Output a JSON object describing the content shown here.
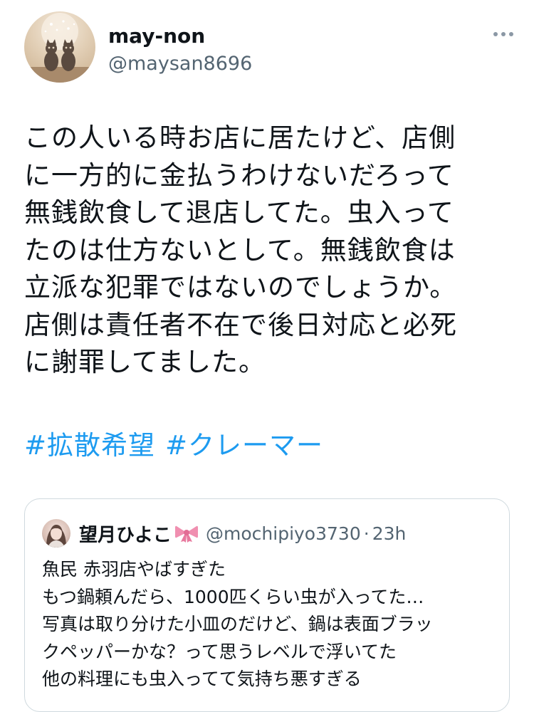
{
  "tweet": {
    "display_name": "may-non",
    "handle": "@maysan8696",
    "body_lines": [
      "この人いる時お店に居たけど、店側",
      "に一方的に金払うわけないだろって",
      "無銭飲食して退店してた。虫入って",
      "たのは仕方ないとして。無銭飲食は",
      "立派な犯罪ではないのでしょうか。",
      "店側は責任者不在で後日対応と必死",
      "に謝罪してました。"
    ],
    "hashtags": [
      "#拡散希望",
      "#クレーマー"
    ]
  },
  "quoted_tweet": {
    "display_name": "望月ひよこ",
    "handle": "@mochipiyo3730",
    "separator": "·",
    "time": "23h",
    "body_lines": [
      "魚民 赤羽店やばすぎた",
      "もつ鍋頼んだら、1000匹くらい虫が入ってた…",
      "写真は取り分けた小皿のだけど、鍋は表面ブラッ",
      "クペッパーかな？って思うレベルで浮いてた",
      "他の料理にも虫入ってて気持ち悪すぎる"
    ]
  },
  "icons": {
    "more": "more-horizontal-icon",
    "ribbon": "ribbon-emoji-icon"
  },
  "colors": {
    "text": "#0f1419",
    "secondary": "#536471",
    "link": "#1d9bf0",
    "border": "#cfd9de",
    "ribbon": "#f08fb0"
  }
}
